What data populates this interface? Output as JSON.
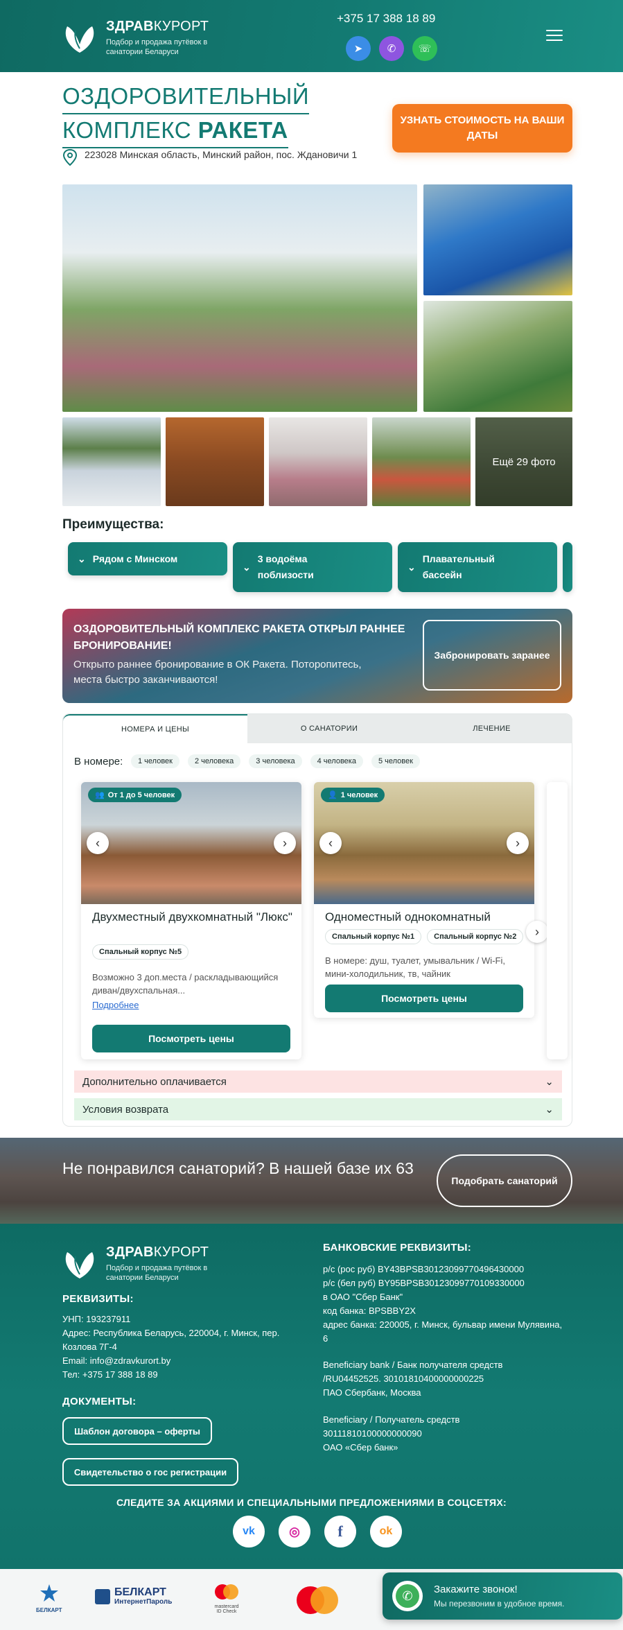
{
  "header": {
    "brand_bold": "ЗДРАВ",
    "brand_light": "КУРОРТ",
    "tagline": "Подбор и продажа путёвок в санатории Беларуси",
    "phone": "+375 17 388 18 89",
    "social_icons": [
      "telegram-icon",
      "viber-icon",
      "whatsapp-icon"
    ],
    "colors": {
      "telegram": "#3b8de6",
      "viber": "#8e55e0",
      "whatsapp": "#2fbf58"
    }
  },
  "title": {
    "line1": "ОЗДОРОВИТЕЛЬНЫЙ",
    "line2_light": "КОМПЛЕКС ",
    "line2_bold": "РАКЕТА"
  },
  "address": "223028 Минская область, Минский район, пос. Ждановичи 1",
  "cta_price": "УЗНАТЬ СТОИМОСТЬ НА ВАШИ ДАТЫ",
  "gallery": {
    "more_photos": "Ещё 29 фото"
  },
  "advantages": {
    "heading": "Преимущества:",
    "items": [
      "Рядом с Минском",
      "3 водоёма поблизости",
      "Плавательный бассейн"
    ]
  },
  "promo": {
    "title": "ОЗДОРОВИТЕЛЬНЫЙ КОМПЛЕКС РАКЕТА ОТКРЫЛ РАННЕЕ БРОНИРОВАНИЕ!",
    "text": "Открыто раннее бронирование в ОК Ракета. Поторопитесь, места быстро заканчиваются!",
    "button": "Забронировать заранее"
  },
  "tabs": {
    "items": [
      "НОМЕРА И ЦЕНЫ",
      "О САНАТОРИИ",
      "ЛЕЧЕНИЕ"
    ],
    "active": 0
  },
  "filter": {
    "label": "В номере:",
    "options": [
      "1 человек",
      "2 человека",
      "3 человека",
      "4 человека",
      "5 человек"
    ]
  },
  "rooms": [
    {
      "badge": "От 1 до 5 человек",
      "name": "Двухместный двухкомнатный \"Люкс\"",
      "building": "Спальный корпус №5",
      "desc": "Возможно 3 доп.места / раскладывающийся диван/двухспальная...",
      "more": "Подробнее",
      "button": "Посмотреть цены"
    },
    {
      "badge": "1 человек",
      "name": "Одноместный однокомнатный",
      "buildings": [
        "Спальный корпус №1",
        "Спальный корпус №2"
      ],
      "desc": "В номере: душ, туалет, умывальник / Wi-Fi, мини-холодильник, тв, чайник",
      "button": "Посмотреть цены"
    }
  ],
  "accordion": {
    "extra": "Дополнительно оплачивается",
    "refund": "Условия возврата",
    "colors": {
      "extra": "#fde3e3",
      "refund": "#e2f5e6"
    }
  },
  "banner": {
    "text": "Не понравился санаторий? В нашей базе их 63",
    "button": "Подобрать санаторий"
  },
  "footer": {
    "brand_bold": "ЗДРАВ",
    "brand_light": "КУРОРТ",
    "tagline": "Подбор и продажа путёвок в санатории Беларуси",
    "req_title": "РЕКВИЗИТЫ:",
    "req_lines": [
      "УНП: 193237911",
      "Адрес: Республика Беларусь, 220004, г. Минск, пер. Козлова 7Г-4",
      "Email: info@zdravkurort.by",
      "Тел: +375 17 388 18 89"
    ],
    "docs_title": "ДОКУМЕНТЫ:",
    "doc1": "Шаблон договора – оферты",
    "doc2": "Свидетельство о гос регистрации",
    "bank_title": "БАНКОВСКИЕ РЕКВИЗИТЫ:",
    "bank_block1": [
      "р/с (рос руб) BY43BPSB30123099770496430000",
      "р/с (бел руб) BY95BPSB30123099770109330000",
      "в ОАО \"Сбер Банк\"",
      "код банка: BPSBBY2X",
      "адрес банка: 220005, г. Минск, бульвар имени Мулявина, 6"
    ],
    "bank_block2": [
      "Beneficiary bank / Банк получателя средств /RU04452525. 30101810400000000225",
      "ПАО Сбербанк, Москва"
    ],
    "bank_block3": [
      "Beneficiary / Получатель средств 30111810100000000090",
      "ОАО «Сбер банк»"
    ],
    "follow": "СЛЕДИТЕ ЗА АКЦИЯМИ И СПЕЦИАЛЬНЫМИ ПРЕДЛОЖЕНИЯМИ В СОЦСЕТЯХ:",
    "socials": [
      {
        "icon": "vk-icon",
        "glyph": "vk",
        "color": "#2787f5"
      },
      {
        "icon": "instagram-icon",
        "glyph": "◎",
        "color": "#d6249f"
      },
      {
        "icon": "facebook-icon",
        "glyph": "f",
        "color": "#3b5998"
      },
      {
        "icon": "odnoklassniki-icon",
        "glyph": "ok",
        "color": "#f7931e"
      }
    ]
  },
  "payments": {
    "belkart": "БЕЛКАРТ",
    "belkart_big": "БЕЛКАРТ",
    "belkart_sub": "ИнтернетПароль",
    "mc_small": "mastercard",
    "mc_sub": "ID Check"
  },
  "callback": {
    "title": "Закажите звонок!",
    "text": "Мы перезвоним в удобное время."
  }
}
